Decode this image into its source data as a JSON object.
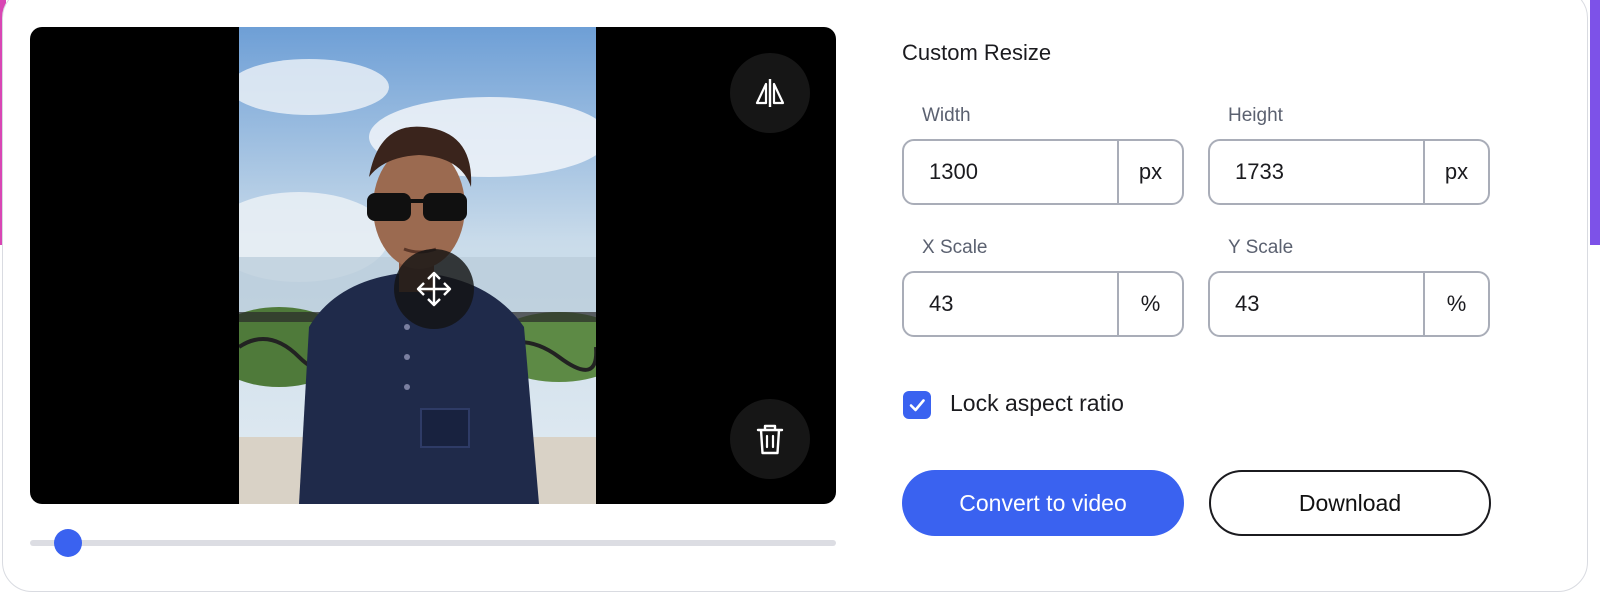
{
  "editor": {
    "slider_position": 0.047,
    "icons": {
      "flip": "flip-horizontal-icon",
      "delete": "trash-icon",
      "move": "move-arrows-icon",
      "check": "checkmark-icon"
    }
  },
  "resize_panel": {
    "title": "Custom Resize",
    "width": {
      "label": "Width",
      "value": "1300",
      "unit": "px"
    },
    "height": {
      "label": "Height",
      "value": "1733",
      "unit": "px"
    },
    "x_scale": {
      "label": "X Scale",
      "value": "43",
      "unit": "%"
    },
    "y_scale": {
      "label": "Y Scale",
      "value": "43",
      "unit": "%"
    },
    "lock_aspect": {
      "label": "Lock aspect ratio",
      "checked": true
    },
    "convert_label": "Convert to video",
    "download_label": "Download"
  },
  "colors": {
    "accent": "#3a62f0",
    "preview_bg": "#000000",
    "border": "#a9adb8"
  }
}
